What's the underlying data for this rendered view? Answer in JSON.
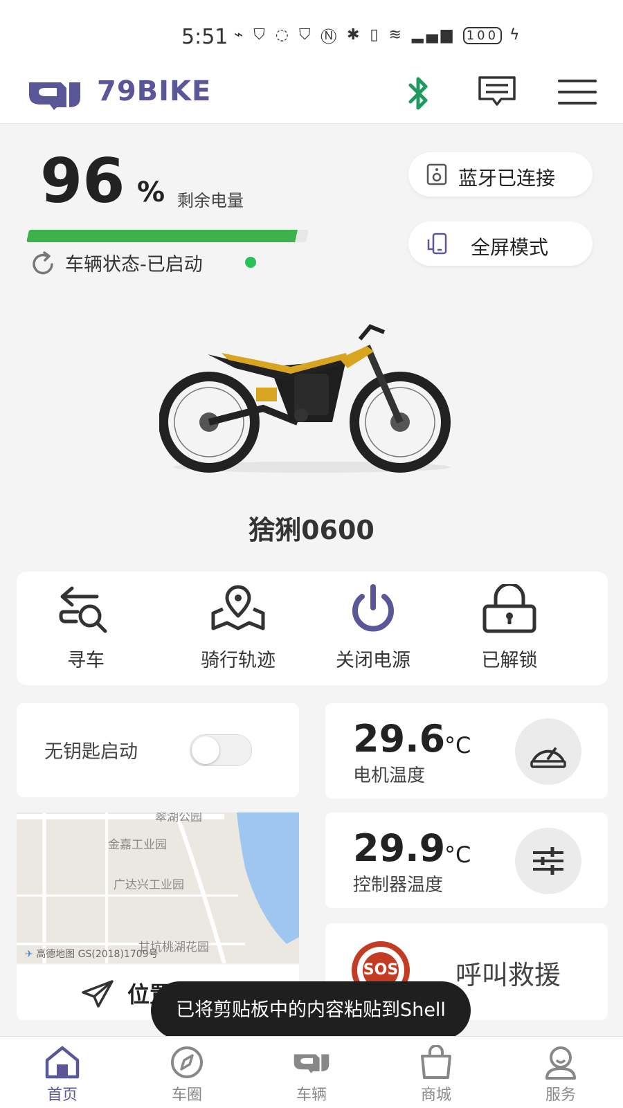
{
  "status_bar": {
    "time": "5:51",
    "battery": "100"
  },
  "header": {
    "brand": "79BIKE"
  },
  "battery": {
    "percent": "96",
    "percent_symbol": "%",
    "label": "剩余电量",
    "level": 0.96
  },
  "vehicle_status": {
    "text": "车辆状态-已启动"
  },
  "pills": {
    "bluetooth": "蓝牙已连接",
    "fullscreen": "全屏模式"
  },
  "bike": {
    "name": "猞猁0600"
  },
  "actions": [
    {
      "label": "寻车",
      "icon": "find-car-icon"
    },
    {
      "label": "骑行轨迹",
      "icon": "route-map-icon"
    },
    {
      "label": "关闭电源",
      "icon": "power-icon"
    },
    {
      "label": "已解锁",
      "icon": "unlock-icon"
    }
  ],
  "keyless": {
    "label": "无钥匙启动",
    "enabled": false
  },
  "map": {
    "labels": [
      "金嘉工业园",
      "广达兴工业园",
      "翠湖公园",
      "甘坑桃湖花园"
    ],
    "provider": "高德地图",
    "license": "GS(2018)1709号"
  },
  "location": {
    "label": "位置信息"
  },
  "motor_temp": {
    "value": "29.6",
    "unit": "°C",
    "label": "电机温度"
  },
  "controller_temp": {
    "value": "29.9",
    "unit": "°C",
    "label": "控制器温度"
  },
  "sos": {
    "badge": "SOS",
    "label": "呼叫救援"
  },
  "toast": {
    "text": "已将剪贴板中的内容粘贴到Shell"
  },
  "tabs": [
    {
      "label": "首页",
      "active": true
    },
    {
      "label": "车圈",
      "active": false
    },
    {
      "label": "车辆",
      "active": false
    },
    {
      "label": "商城",
      "active": false
    },
    {
      "label": "服务",
      "active": false
    }
  ],
  "colors": {
    "brand": "#5a5799",
    "battery_green": "#3bb34a",
    "status_dot": "#29c25a",
    "sos_red": "#c23b22",
    "bluetooth": "#1f9a5e"
  }
}
